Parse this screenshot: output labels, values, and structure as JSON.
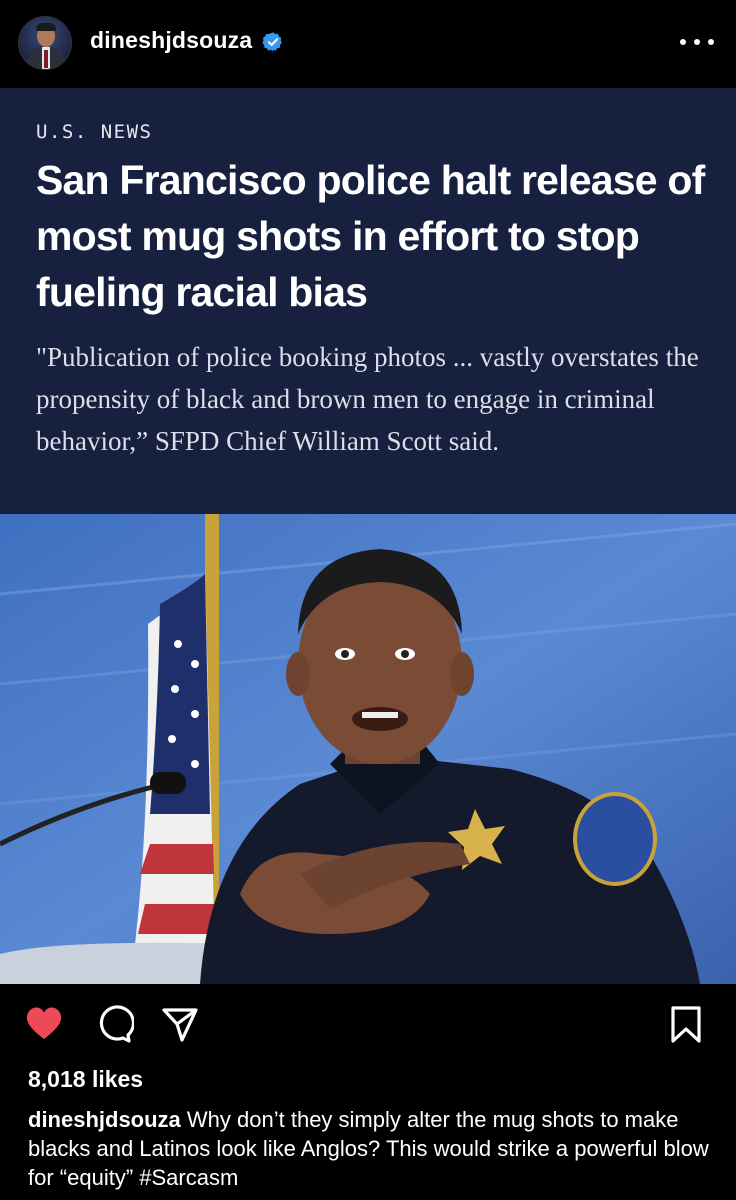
{
  "post": {
    "username": "dineshjdsouza",
    "verified": true,
    "likes_text": "8,018 likes",
    "caption_user": "dineshjdsouza",
    "caption_text": "Why don’t they simply alter the mug shots to make blacks and Latinos look like Anglos? This would strike a powerful blow for “equity” #Sarcasm",
    "liked": true
  },
  "article": {
    "kicker": "U.S. NEWS",
    "headline": "San Francisco police halt release of most mug shots in effort to stop fueling racial bias",
    "dek": "\"Publication of police booking photos ... vastly overstates the propensity of black and brown men to engage in criminal behavior,” SFPD Chief William Scott said."
  },
  "icons": {
    "more": "more-options-icon",
    "like": "heart-icon",
    "comment": "comment-icon",
    "share": "share-icon",
    "save": "bookmark-icon",
    "verified": "verified-badge-icon"
  },
  "colors": {
    "background": "#000000",
    "article_bg": "#17213f",
    "like_red": "#ed4956",
    "verified_blue": "#3897f0"
  }
}
